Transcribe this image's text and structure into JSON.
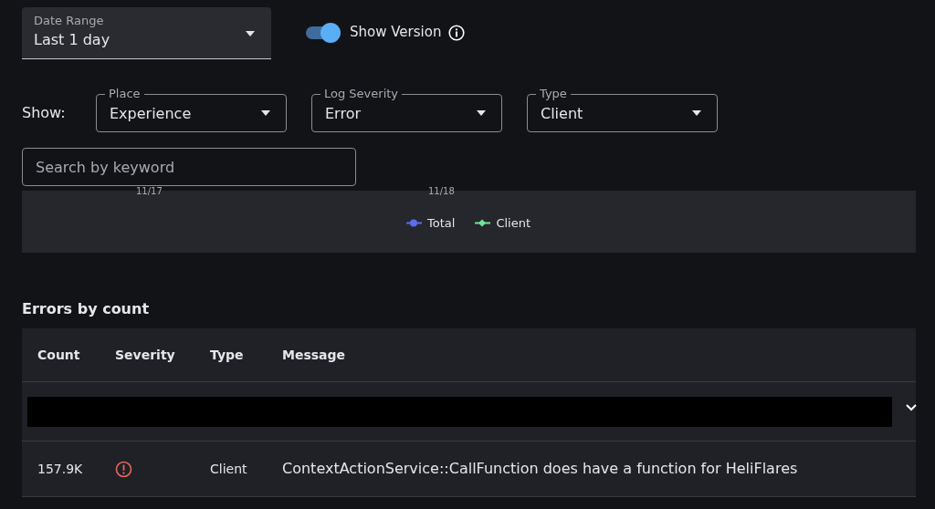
{
  "date_range": {
    "label": "Date Range",
    "value": "Last 1 day"
  },
  "show_version": {
    "label": "Show Version",
    "on": true
  },
  "filters": {
    "label": "Show:",
    "selects": [
      {
        "label": "Place",
        "value": "Experience"
      },
      {
        "label": "Log Severity",
        "value": "Error"
      },
      {
        "label": "Type",
        "value": "Client"
      }
    ]
  },
  "search": {
    "placeholder": "Search by keyword"
  },
  "chart": {
    "x_labels": [
      "11/17",
      "11/18"
    ],
    "legend": [
      {
        "label": "Total",
        "color": "#5a6cf0",
        "kind": "circle"
      },
      {
        "label": "Client",
        "color": "#6ee69a",
        "kind": "diamond"
      }
    ]
  },
  "errors": {
    "title": "Errors by count",
    "columns": [
      "Count",
      "Severity",
      "Type",
      "Message"
    ],
    "rows": [
      {
        "kind": "redacted",
        "expanded": false
      },
      {
        "kind": "error",
        "count": "157.9K",
        "type": "Client",
        "message": "ContextActionService::CallFunction does have a function for HeliFlares"
      }
    ]
  }
}
